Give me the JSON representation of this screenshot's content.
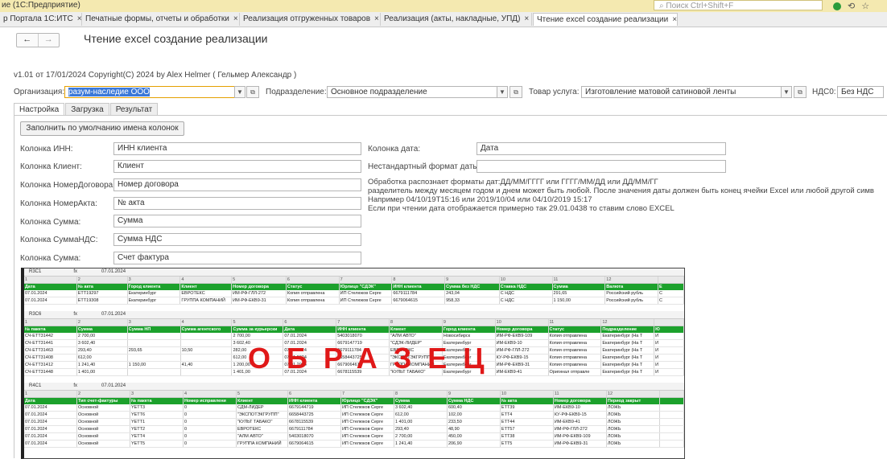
{
  "app": {
    "title": "ие (1С:Предприятие)",
    "search_placeholder": "Поиск Ctrl+Shift+F"
  },
  "window_tabs": [
    {
      "label": "р Портала 1С:ИТС"
    },
    {
      "label": "Печатные формы, отчеты и обработки"
    },
    {
      "label": "Реализация отгруженных товаров"
    },
    {
      "label": "Реализация (акты, накладные, УПД)"
    },
    {
      "label": "Чтение excel создание реализации"
    }
  ],
  "page": {
    "title": "Чтение excel создание реализации",
    "version": "v1.01 от 17/01/2024  Copyright(C) 2024 by Alex Helmer ( Гельмер Александр )"
  },
  "header_fields": {
    "org_label": "Организация:",
    "org_value": "разум-наследие ООО",
    "dept_label": "Подразделение:",
    "dept_value": "Основное подразделение",
    "service_label": "Товар услуга:",
    "service_value": "Изготовление матовой сатиновой ленты",
    "vat_label": "НДС0:",
    "vat_value": "Без НДС"
  },
  "form_tabs": [
    "Настройка",
    "Загрузка",
    "Результат"
  ],
  "fill_button": "Заполнить по умолчанию имена колонок",
  "columns": [
    {
      "label": "Колонка ИНН:",
      "value": "ИНН клиента"
    },
    {
      "label": "Колонка Клиент:",
      "value": "Клиент"
    },
    {
      "label": "Колонка НомерДоговора:",
      "value": "Номер договора"
    },
    {
      "label": "Колонка НомерАкта:",
      "value": "№ акта"
    },
    {
      "label": "Колонка Сумма:",
      "value": "Сумма"
    },
    {
      "label": "Колонка СуммаНДС:",
      "value": "Сумма НДС"
    },
    {
      "label": "Колонка Сумма:",
      "value": "Счет фактура"
    }
  ],
  "date_fields": {
    "date_label": "Колонка дата:",
    "date_value": "Дата",
    "custom_label": "Нестандартный формат даты:",
    "custom_value": ""
  },
  "notes": [
    "Обработка распознает форматы дат:ДД/ММ/ГГГГ или ГГГГ/ММ/ДД или ДД/ММ/ГГ",
    "разделитель между месяцем годом и днем может быть любой. После значения даты должен быть конец ячейки Excel или любой другой симв",
    "Например 04/10/19T15:16 или 2019/10/04 или 04/10/2019 15:17",
    "Если при чтении дата отображается примерно так 29.01.0438 то ставим слово EXCEL"
  ],
  "watermark": "ОБРАЗЕЦ",
  "sample_sheets": [
    {
      "cell_ref": "R3C1",
      "formula": "07.01.2024",
      "widths": [
        68,
        65,
        68,
        66,
        70,
        68,
        68,
        68,
        70,
        68,
        68,
        68,
        33
      ],
      "col_headers": [
        "1",
        "2",
        "3",
        "4",
        "5",
        "6",
        "7",
        "8",
        "9",
        "10",
        "11",
        "12",
        ""
      ],
      "header": [
        "Дата",
        "№ акта",
        "Город клиента",
        "Клиент",
        "Номер договора",
        "Статус",
        "Юрлицо \"СДЭК\"",
        "ИНН клиента",
        "Сумма без НДС",
        "Ставка НДС",
        "Сумма",
        "Валюта",
        "Е"
      ],
      "rows": [
        [
          "07.01.2024",
          "ETT19297",
          "Екатеринбург",
          "ЕВРОТЕКС",
          "ИМ-РФ-ГЛЛ-272",
          "Копия отправлена",
          "ИП Стелюков Серге",
          "6679111784",
          "243,04",
          "С НДС",
          "291,65",
          "Российский рубль",
          "С"
        ],
        [
          "07.01.2024",
          "ETT19308",
          "Екатеринбург",
          "ГРУППА КОМПАНИЙ",
          "ИМ-РФ-ЕКВ9-31",
          "Копия отправлена",
          "ИП Стелюков Серге",
          "6679064615",
          "958,33",
          "С НДС",
          "1 150,00",
          "Российский рубль",
          "С"
        ]
      ]
    },
    {
      "cell_ref": "R3C6",
      "formula": "07.01.2024",
      "widths": [
        68,
        65,
        68,
        66,
        66,
        68,
        68,
        68,
        68,
        68,
        68,
        68,
        38
      ],
      "col_headers": [
        "1",
        "2",
        "3",
        "4",
        "5",
        "6",
        "7",
        "8",
        "9",
        "10",
        "11",
        "12",
        ""
      ],
      "header": [
        "№ пакета",
        "Сумма",
        "Сумма НП",
        "Сумма агентского",
        "Сумма за курьерски",
        "Дата",
        "ИНН клиента",
        "Клиент",
        "Город клиента",
        "Номер договора",
        "Статус",
        "Подразделение",
        "Ю"
      ],
      "rows": [
        [
          "СЧ-ЕТТ31442",
          "2 700,00",
          "",
          "",
          "2 700,00",
          "07.01.2024",
          "5403018070",
          "\"АЛМ АВТО\"",
          "Новосибирск",
          "ИМ-РФ-ЕКВ9-109",
          "Копия отправлена",
          "Екатеринбург (На Т",
          "И"
        ],
        [
          "СЧ-ЕТТ31441",
          "3 602,40",
          "",
          "",
          "3 602,40",
          "07.01.2024",
          "6679147719",
          "\"СДЭК-ЛИДЕР\"",
          "Екатеринбург",
          "ИМ-ЕКВ9-10",
          "Копия отправлена",
          "Екатеринбург (На Т",
          "И"
        ],
        [
          "СЧ-ЕТТ31463",
          "293,40",
          "293,65",
          "10,50",
          "282,00",
          "07.01.2024",
          "6679111784",
          "ЕВРОТЕКС",
          "Екатеринбург",
          "ИМ-РФ-ГЛЛ-272",
          "Копия отправлена",
          "Екатеринбург (На Т",
          "И"
        ],
        [
          "СЧ-ЕТТ31408",
          "612,00",
          "",
          "",
          "612,00",
          "07.01.2024",
          "6658443725",
          "\"ЭКСПОТЭКГРУПП\"",
          "Екатеринбург",
          "КУ-РФ-ЕКВ9-15",
          "Копия отправлена",
          "Екатеринбург (На Т",
          "И"
        ],
        [
          "СЧ-ЕТТ31412",
          "1 241,40",
          "1 150,00",
          "41,40",
          "1 200,00",
          "07.01.2024",
          "6679064615",
          "ГРУППА КОМПАНИЙ",
          "Екатеринбург",
          "ИМ-РФ-ЕКВ9-31",
          "Копия отправлена",
          "Екатеринбург (На Т",
          "И"
        ],
        [
          "СЧ-ЕТТ31448",
          "1 401,00",
          "",
          "",
          "1 401,00",
          "07.01.2024",
          "6678115539",
          "\"КУЛЬТ ТАБАКО\"",
          "Екатеринбург",
          "ИМ-ЕКВ9-41",
          "Оригинал отправле",
          "Екатеринбург (На Т",
          "И"
        ]
      ]
    },
    {
      "cell_ref": "R4C1",
      "formula": "07.01.2024",
      "widths": [
        68,
        68,
        68,
        68,
        66,
        68,
        68,
        68,
        68,
        68,
        68,
        68,
        31
      ],
      "col_headers": [
        "1",
        "2",
        "3",
        "4",
        "5",
        "6",
        "7",
        "8",
        "9",
        "10",
        "11",
        "12",
        ""
      ],
      "header": [
        "Дата",
        "Тип счет-фактуры",
        "№ пакета",
        "Номер исправлени",
        "Клиент",
        "ИНН клиента",
        "Юрлицо \"СДЭК\"",
        "Сумма",
        "Сумма НДС",
        "№ акта",
        "Номер договора",
        "Период закрыт",
        ""
      ],
      "rows": [
        [
          "07.01.2024",
          "Основной",
          "YETT3",
          "0",
          "СДМ-ЛИДЕР",
          "6679144719",
          "ИП Стелюков Серге",
          "3 602,40",
          "600,40",
          "ETT39",
          "ИМ-ЕКВ9-10",
          "ЛОЖЬ",
          ""
        ],
        [
          "07.01.2024",
          "Основной",
          "YETT6",
          "0",
          "\"ЭКСПОТЭКГРУПП\"",
          "6658443725",
          "ИП Стелюков Серге",
          "612,00",
          "102,00",
          "ETT4",
          "КУ-РФ-ЕКВ9-15",
          "ЛОЖЬ",
          ""
        ],
        [
          "07.01.2024",
          "Основной",
          "YETT1",
          "0",
          "\"КУЛЬТ ТАБАКО\"",
          "6678115539",
          "ИП Стелюков Серге",
          "1 401,00",
          "233,50",
          "ETT44",
          "ИМ-ЕКВ9-41",
          "ЛОЖЬ",
          ""
        ],
        [
          "07.01.2024",
          "Основной",
          "YETT2",
          "0",
          "ЕВРОТЕКС",
          "6679111784",
          "ИП Стелюков Серге",
          "293,40",
          "48,90",
          "ETT57",
          "ИМ-РФ-ГЛЛ-272",
          "ЛОЖЬ",
          ""
        ],
        [
          "07.01.2024",
          "Основной",
          "YETT4",
          "0",
          "\"АЛМ АВТО\"",
          "5403018070",
          "ИП Стелюков Серге",
          "2 700,00",
          "450,00",
          "ETT38",
          "ИМ-РФ-ЕКВ9-109",
          "ЛОЖЬ",
          ""
        ],
        [
          "07.01.2024",
          "Основной",
          "YETT5",
          "0",
          "ГРУППА КОМПАНИЙ",
          "6679064615",
          "ИП Стелюков Серге",
          "1 241,40",
          "206,90",
          "ETT5",
          "ИМ-РФ-ЕКВ9-31",
          "ЛОЖЬ",
          ""
        ]
      ]
    }
  ]
}
